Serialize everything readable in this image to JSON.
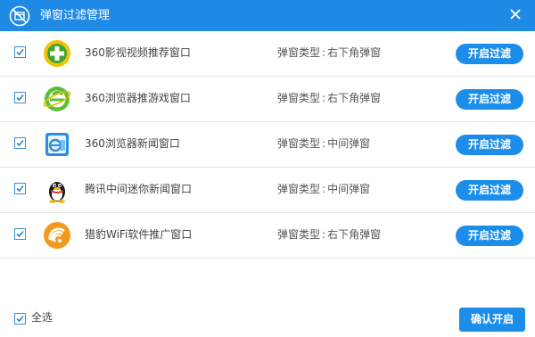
{
  "window": {
    "title": "弹窗过滤管理",
    "accent_color": "#1f8ae6",
    "button_color": "#1c8ee9"
  },
  "rows": [
    {
      "checked": true,
      "icon": "360-video-icon",
      "name": "360影视视频推荐窗口",
      "type_label": "弹窗类型",
      "type_value": "右下角弹窗",
      "button_label": "开启过滤"
    },
    {
      "checked": true,
      "icon": "360-browser-icon",
      "name": "360浏览器推游戏窗口",
      "type_label": "弹窗类型",
      "type_value": "右下角弹窗",
      "button_label": "开启过滤"
    },
    {
      "checked": true,
      "icon": "360-browser-news-icon",
      "name": "360浏览器新闻窗口",
      "type_label": "弹窗类型",
      "type_value": "中间弹窗",
      "button_label": "开启过滤"
    },
    {
      "checked": true,
      "icon": "qq-penguin-icon",
      "name": "腾讯中间迷你新闻窗口",
      "type_label": "弹窗类型",
      "type_value": "中间弹窗",
      "button_label": "开启过滤"
    },
    {
      "checked": true,
      "icon": "cheetah-wifi-icon",
      "name": "猎豹WiFi软件推广窗口",
      "type_label": "弹窗类型",
      "type_value": "右下角弹窗",
      "button_label": "开启过滤"
    }
  ],
  "footer": {
    "select_all_label": "全选",
    "select_all_checked": true,
    "confirm_label": "确认开启"
  }
}
